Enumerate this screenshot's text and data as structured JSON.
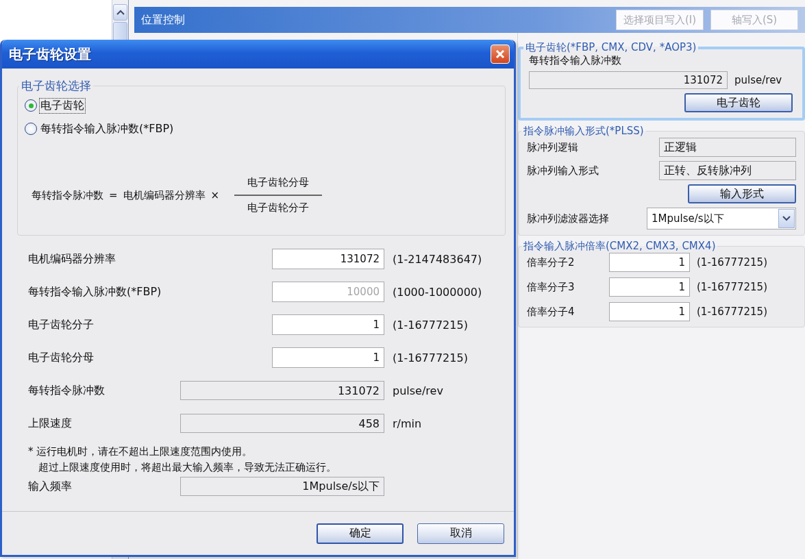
{
  "header": {
    "title": "位置控制",
    "buttons": [
      {
        "label": "选择项目写入(I)",
        "disabled": true
      },
      {
        "label": "轴写入(S)",
        "disabled": true
      }
    ]
  },
  "right_panel": {
    "gear_group": {
      "title": "电子齿轮(*FBP, CMX, CDV, *AOP3)",
      "focused": true,
      "label": "每转指令输入脉冲数",
      "value": "131072",
      "unit": "pulse/rev",
      "button": "电子齿轮"
    },
    "pulse_group": {
      "title": "指令脉冲输入形式(*PLSS)",
      "rows": [
        {
          "label": "脉冲列逻辑",
          "value": "正逻辑"
        },
        {
          "label": "脉冲列输入形式",
          "value": "正转、反转脉冲列"
        }
      ],
      "button": "输入形式",
      "filter": {
        "label": "脉冲列滤波器选择",
        "value": "1Mpulse/s以下"
      }
    },
    "ratio_group": {
      "title": "指令输入脉冲倍率(CMX2, CMX3, CMX4)",
      "rows": [
        {
          "label": "倍率分子2",
          "value": "1",
          "range": "(1-16777215)"
        },
        {
          "label": "倍率分子3",
          "value": "1",
          "range": "(1-16777215)"
        },
        {
          "label": "倍率分子4",
          "value": "1",
          "range": "(1-16777215)"
        }
      ]
    }
  },
  "dialog": {
    "title": "电子齿轮设置",
    "selection": {
      "title": "电子齿轮选择",
      "options": [
        {
          "label": "电子齿轮",
          "selected": true
        },
        {
          "label": "每转指令输入脉冲数(*FBP)",
          "selected": false
        }
      ],
      "formula": {
        "result": "每转指令脉冲数",
        "equals": "=",
        "term": "电机编码器分辨率",
        "times": "×",
        "numerator": "电子齿轮分母",
        "denominator": "电子齿轮分子"
      }
    },
    "fields": [
      {
        "kind": "input",
        "label": "电机编码器分辨率",
        "value": "131072",
        "range": "(1-2147483647)",
        "disabled": false
      },
      {
        "kind": "input",
        "label": "每转指令输入脉冲数(*FBP)",
        "value": "10000",
        "range": "(1000-1000000)",
        "disabled": true
      },
      {
        "kind": "input",
        "label": "电子齿轮分子",
        "value": "1",
        "range": "(1-16777215)",
        "disabled": false
      },
      {
        "kind": "input",
        "label": "电子齿轮分母",
        "value": "1",
        "range": "(1-16777215)",
        "disabled": false
      },
      {
        "kind": "readout",
        "label": "每转指令脉冲数",
        "value": "131072",
        "unit": "pulse/rev"
      },
      {
        "kind": "readout",
        "label": "上限速度",
        "value": "458",
        "unit": "r/min"
      }
    ],
    "note": [
      "* 运行电机时，请在不超出上限速度范围内使用。",
      "超过上限速度使用时，将超出最大输入频率，导致无法正确运行。"
    ],
    "frequency": {
      "label": "输入频率",
      "value": "1Mpulse/s以下"
    },
    "buttons": [
      {
        "label": "确定",
        "default": true
      },
      {
        "label": "取消",
        "default": false
      }
    ]
  }
}
